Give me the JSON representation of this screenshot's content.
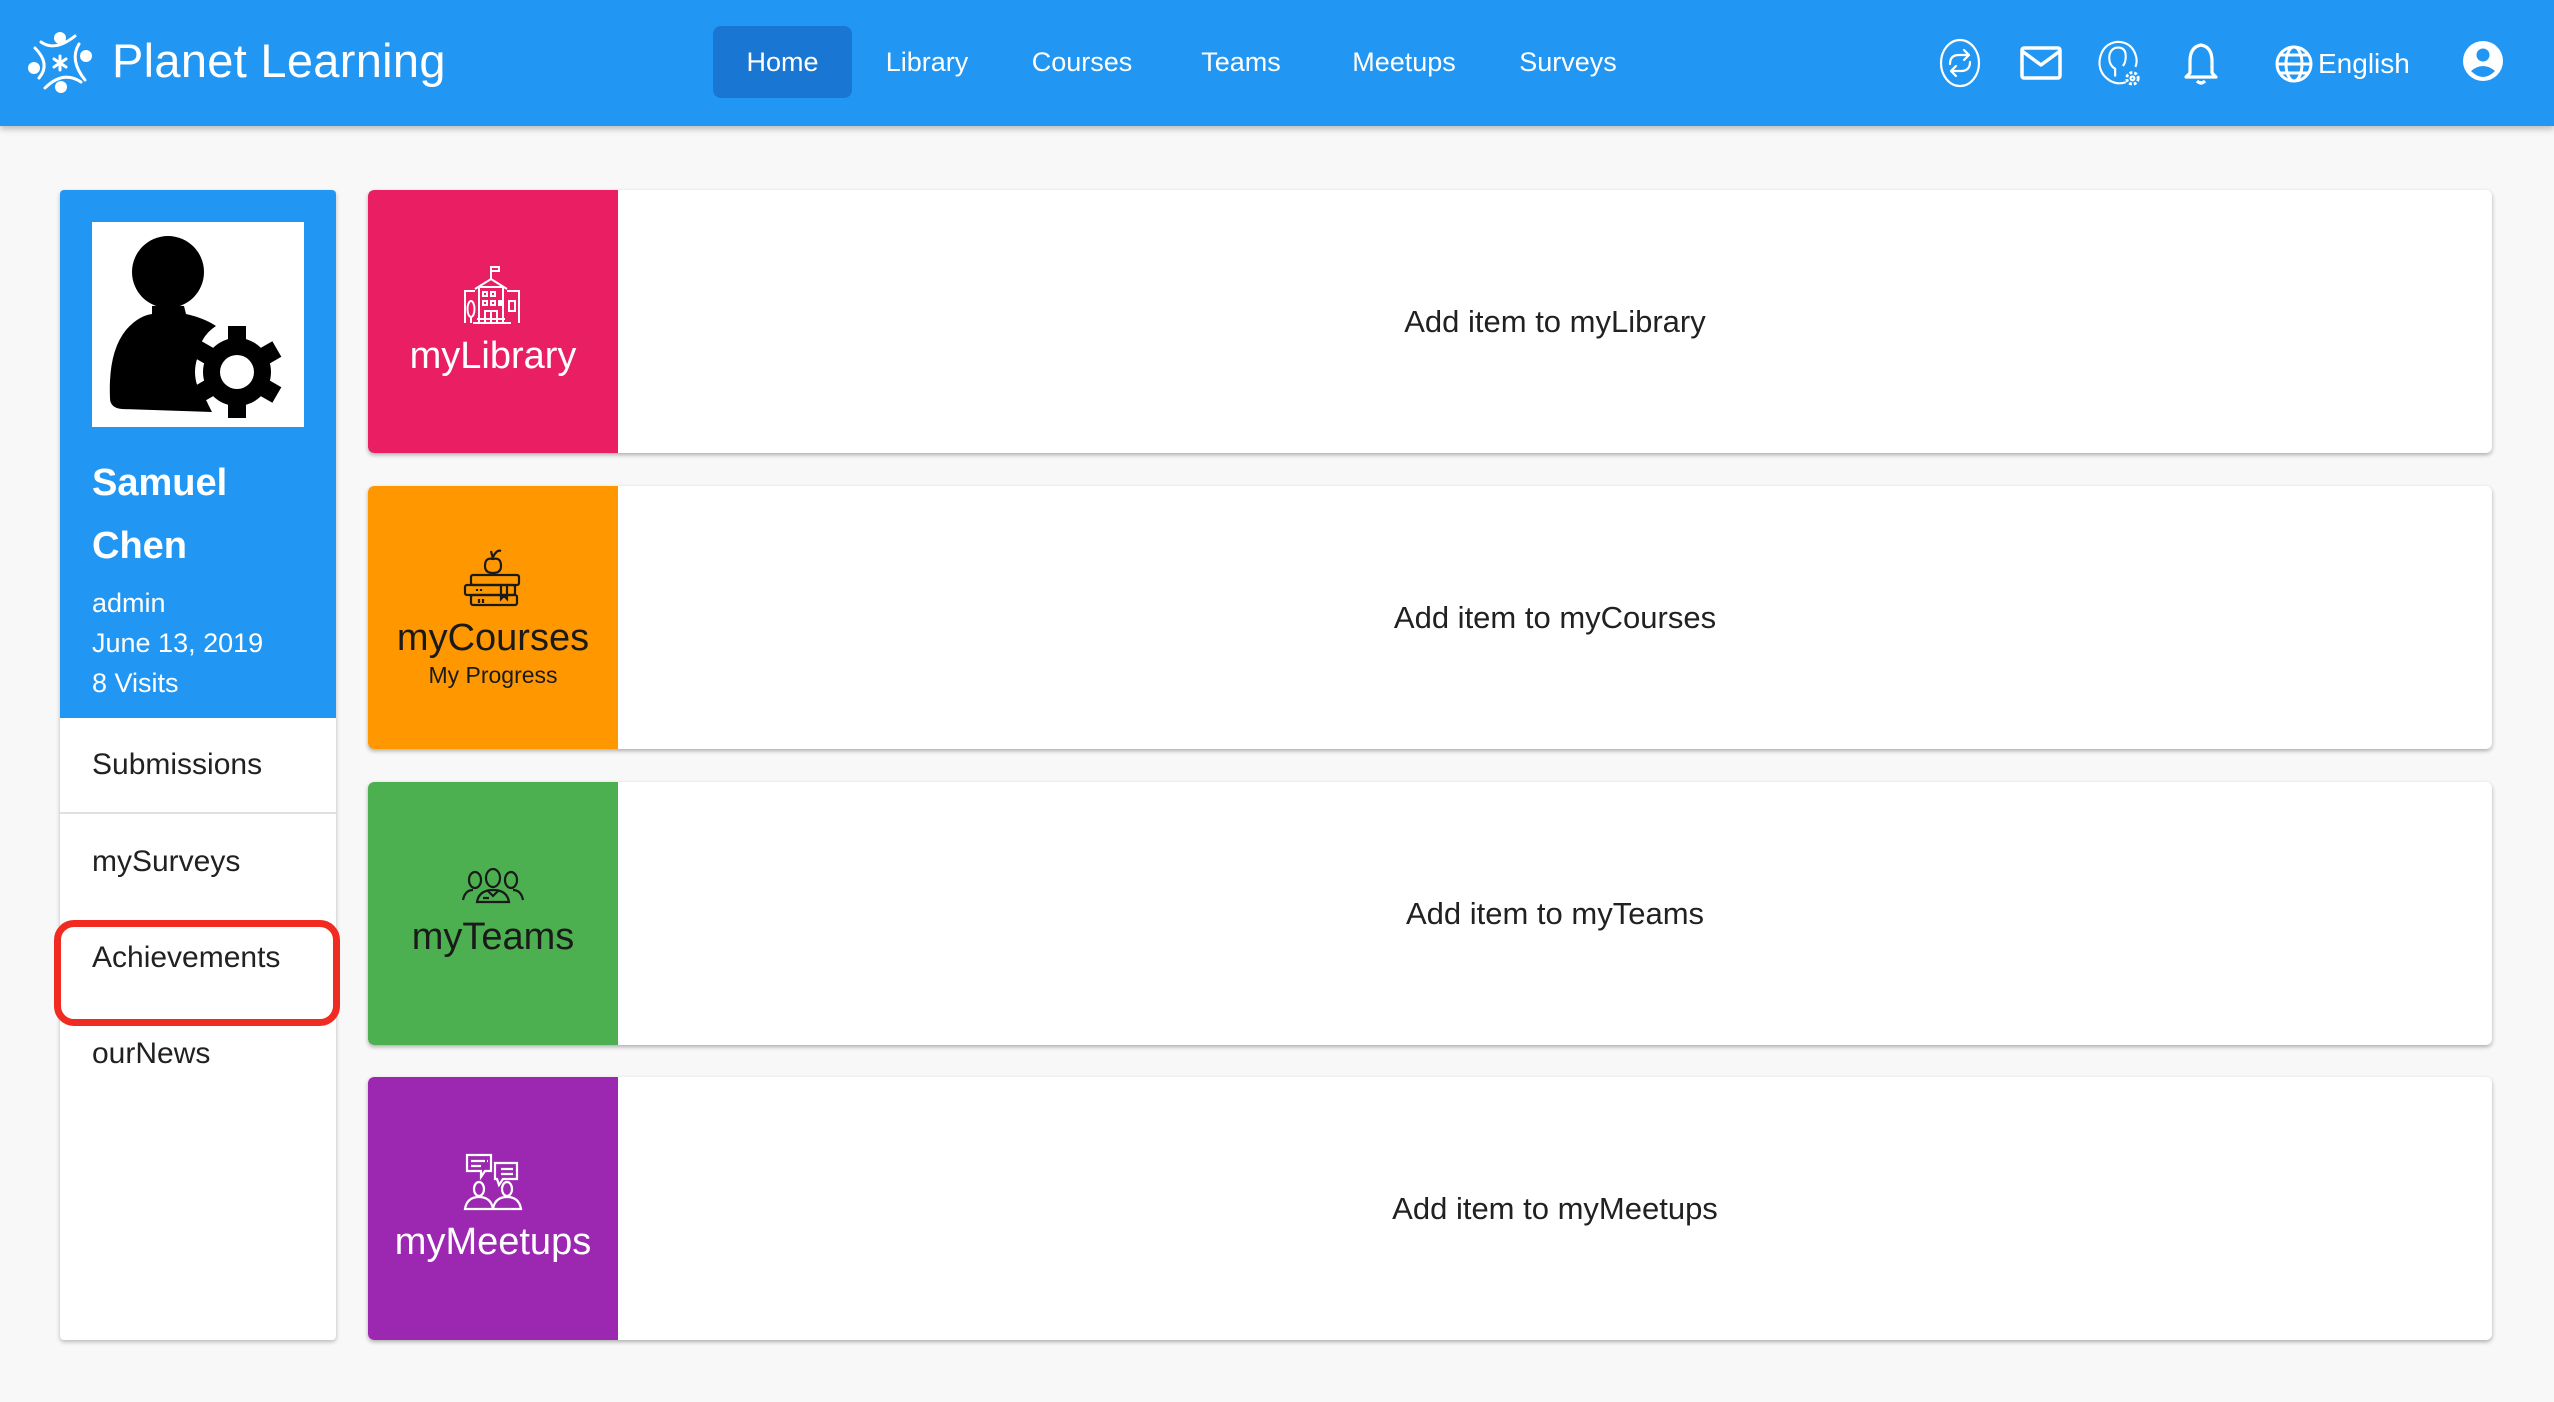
{
  "header": {
    "app_title": "Planet Learning",
    "logo_icon": "planet-learning-logo",
    "nav": [
      {
        "label": "Home",
        "active": true
      },
      {
        "label": "Library",
        "active": false
      },
      {
        "label": "Courses",
        "active": false
      },
      {
        "label": "Teams",
        "active": false
      },
      {
        "label": "Meetups",
        "active": false
      },
      {
        "label": "Surveys",
        "active": false
      }
    ],
    "tools": [
      "sync-icon",
      "mail-icon",
      "user-settings-icon",
      "bell-icon"
    ],
    "language": "English",
    "account_icon": "account-circle-icon",
    "color": "#2196f3",
    "active_color": "#1976d2"
  },
  "profile": {
    "first_name": "Samuel",
    "last_name": "Chen",
    "role": "admin",
    "date": "June 13, 2019",
    "visits": "8 Visits"
  },
  "sidebar": {
    "items": [
      {
        "label": "Submissions"
      },
      {
        "label": "mySurveys"
      },
      {
        "label": "Achievements",
        "highlighted": true
      },
      {
        "label": "ourNews"
      }
    ]
  },
  "cards": [
    {
      "tile_label": "myLibrary",
      "tile_sub": "",
      "icon": "school-building-icon",
      "color": "#e91e63",
      "text": "Add item to myLibrary"
    },
    {
      "tile_label": "myCourses",
      "tile_sub": "My Progress",
      "icon": "books-apple-icon",
      "color": "#ff9800",
      "text": "Add item to myCourses"
    },
    {
      "tile_label": "myTeams",
      "tile_sub": "",
      "icon": "team-group-icon",
      "color": "#4caf50",
      "text": "Add item to myTeams"
    },
    {
      "tile_label": "myMeetups",
      "tile_sub": "",
      "icon": "meetup-chat-icon",
      "color": "#9c27b0",
      "text": "Add item to myMeetups"
    }
  ]
}
